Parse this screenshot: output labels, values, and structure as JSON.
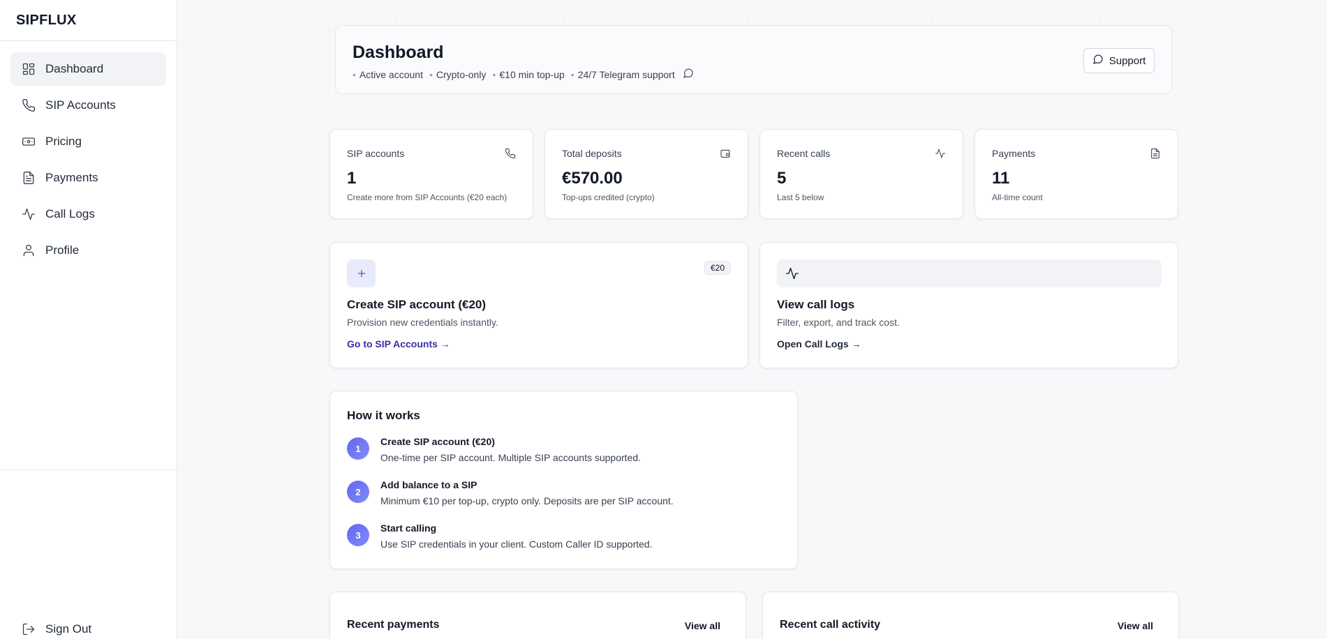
{
  "app": {
    "brand": "SIPFLUX"
  },
  "sidebar": {
    "items": [
      {
        "label": "Dashboard",
        "icon": "dashboard-icon",
        "active": true
      },
      {
        "label": "SIP Accounts",
        "icon": "phone-icon"
      },
      {
        "label": "Pricing",
        "icon": "banknote-icon"
      },
      {
        "label": "Payments",
        "icon": "file-text-icon"
      },
      {
        "label": "Call Logs",
        "icon": "activity-icon"
      },
      {
        "label": "Profile",
        "icon": "user-icon"
      }
    ],
    "sign_out": "Sign Out"
  },
  "header": {
    "title": "Dashboard",
    "meta": [
      "Active account",
      "Crypto-only",
      "€10 min top-up",
      "24/7 Telegram support"
    ],
    "support_label": "Support"
  },
  "stats": [
    {
      "label": "SIP accounts",
      "value": "1",
      "sub": "Create more from SIP Accounts (€20 each)",
      "icon": "phone-icon"
    },
    {
      "label": "Total deposits",
      "value": "€570.00",
      "sub": "Top-ups credited (crypto)",
      "icon": "wallet-icon"
    },
    {
      "label": "Recent calls",
      "value": "5",
      "sub": "Last 5 below",
      "icon": "activity-icon"
    },
    {
      "label": "Payments",
      "value": "11",
      "sub": "All-time count",
      "icon": "file-text-icon"
    }
  ],
  "actions": {
    "create": {
      "badge": "€20",
      "title": "Create SIP account (€20)",
      "desc": "Provision new credentials instantly.",
      "link": "Go to SIP Accounts →"
    },
    "logs": {
      "title": "View call logs",
      "desc": "Filter, export, and track cost.",
      "link": "Open Call Logs →"
    }
  },
  "how": {
    "title": "How it works",
    "steps": [
      {
        "num": "1",
        "title": "Create SIP account (€20)",
        "desc": "One-time per SIP account. Multiple SIP accounts supported."
      },
      {
        "num": "2",
        "title": "Add balance to a SIP",
        "desc": "Minimum €10 per top-up, crypto only. Deposits are per SIP account."
      },
      {
        "num": "3",
        "title": "Start calling",
        "desc": "Use SIP credentials in your client. Custom Caller ID supported."
      }
    ]
  },
  "recent": {
    "payments": {
      "title": "Recent payments",
      "view_all": "View all"
    },
    "calls": {
      "title": "Recent call activity",
      "view_all": "View all"
    }
  },
  "colors": {
    "accent": "#6366f1",
    "link": "#3730a3",
    "background": "#f7f8fa"
  }
}
